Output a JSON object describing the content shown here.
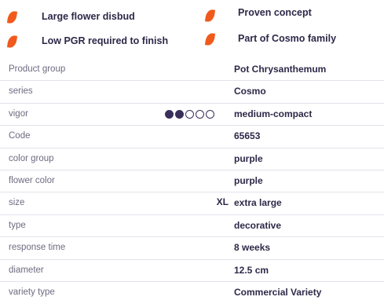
{
  "features": [
    {
      "text": "Large flower disbud",
      "icon": "orange-leaf-icon"
    },
    {
      "text": "Low PGR required to finish",
      "icon": "orange-leaf-icon"
    },
    {
      "text": "Proven concept",
      "icon": "orange-leaf-icon"
    },
    {
      "text": "Part of Cosmo family",
      "icon": "orange-leaf-icon"
    }
  ],
  "colors": {
    "accent": "#f05a1c",
    "text": "#2e2848",
    "label": "#6f6a80",
    "divider": "#e4e2ea"
  },
  "rows": [
    {
      "label": "Product group",
      "value": "Pot Chrysanthemum"
    },
    {
      "label": "series",
      "value": "Cosmo"
    },
    {
      "label": "vigor",
      "value": "medium-compact",
      "vigor_level": 2,
      "vigor_max": 5
    },
    {
      "label": "Code",
      "value": "65653"
    },
    {
      "label": "color group",
      "value": "purple"
    },
    {
      "label": "flower color",
      "value": "purple"
    },
    {
      "label": "size",
      "value": "extra large",
      "badge": "XL"
    },
    {
      "label": "type",
      "value": "decorative"
    },
    {
      "label": "response time",
      "value": "8 weeks"
    },
    {
      "label": "diameter",
      "value": "12.5 cm"
    },
    {
      "label": "variety type",
      "value": "Commercial Variety"
    }
  ]
}
